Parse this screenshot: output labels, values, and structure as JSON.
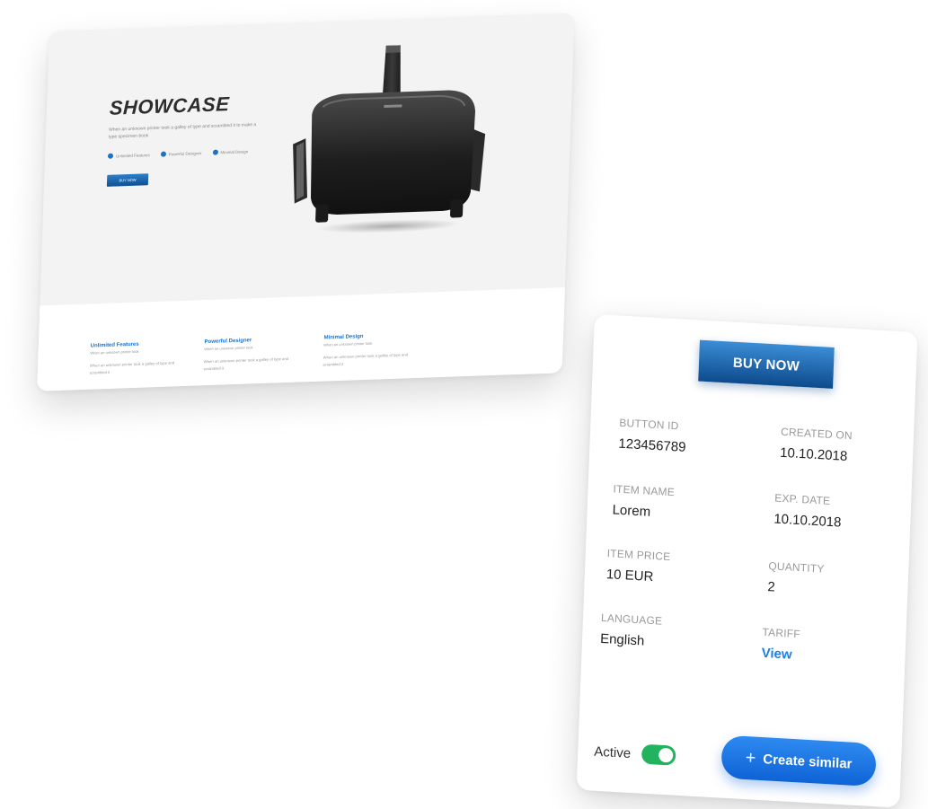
{
  "showcase": {
    "title": "SHOWCASE",
    "description": "When an unknown printer took a galley of type and scrambled it to make a type specimen book",
    "options": [
      "Unlimited Features",
      "Powerful Designer",
      "Minimal Design"
    ],
    "buy_label": "BUY NOW",
    "features": [
      {
        "title": "Unlimited Features",
        "subtitle": "When an unknown printer took",
        "desc": "When an unknown printer took a galley of type and scrambled it"
      },
      {
        "title": "Powerful Designer",
        "subtitle": "When an unknown printer took",
        "desc": "When an unknown printer took a galley of type and scrambled it"
      },
      {
        "title": "Minimal Design",
        "subtitle": "When an unknown printer took",
        "desc": "When an unknown printer took a galley of type and scrambled it"
      }
    ]
  },
  "details": {
    "buy_label": "BUY NOW",
    "fields": {
      "button_id": {
        "label": "BUTTON ID",
        "value": "123456789"
      },
      "created_on": {
        "label": "CREATED ON",
        "value": "10.10.2018"
      },
      "item_name": {
        "label": "ITEM NAME",
        "value": "Lorem"
      },
      "exp_date": {
        "label": "EXP. DATE",
        "value": "10.10.2018"
      },
      "item_price": {
        "label": "ITEM PRICE",
        "value": "10 EUR"
      },
      "quantity": {
        "label": "QUANTITY",
        "value": "2"
      },
      "language": {
        "label": "LANGUAGE",
        "value": "English"
      },
      "tariff": {
        "label": "TARIFF",
        "value": "View"
      }
    },
    "active_label": "Active",
    "active": true,
    "create_label": "Create similar"
  },
  "colors": {
    "accent": "#1f7fe6",
    "button_dark": "#0d4a8c",
    "toggle_on": "#22b35e"
  }
}
